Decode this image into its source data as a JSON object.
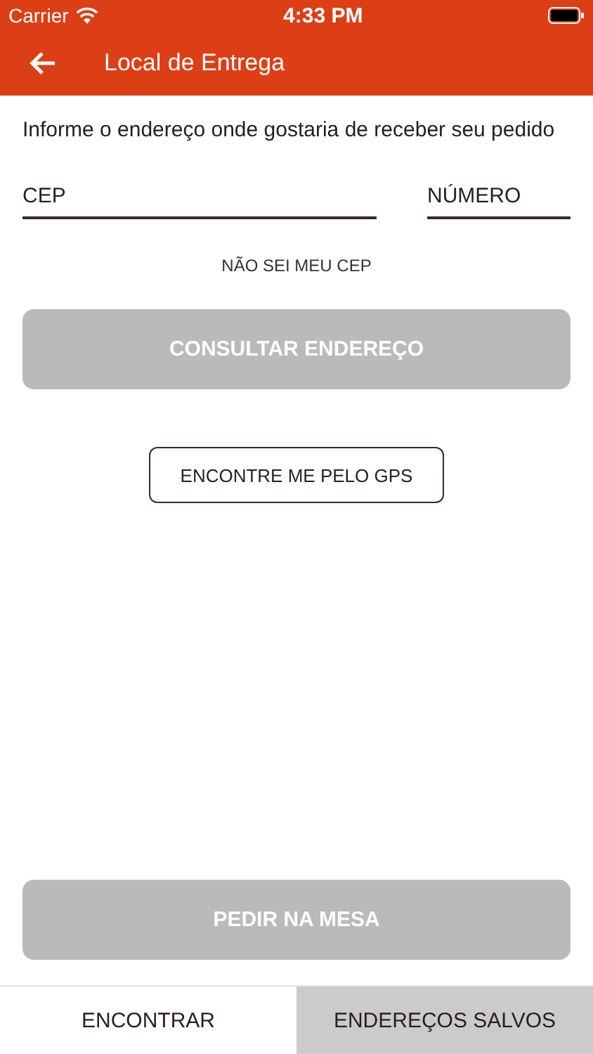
{
  "status_bar": {
    "carrier": "Carrier",
    "time": "4:33 PM"
  },
  "header": {
    "title": "Local de Entrega"
  },
  "instruction": "Informe o endereço onde gostaria de receber seu pedido",
  "fields": [
    {
      "placeholder": "CEP"
    },
    {
      "placeholder": "NÚMERO"
    }
  ],
  "unknown_cep_link": "NÃO SEI MEU CEP",
  "lookup_button": {
    "label": "CONSULTAR ENDEREÇO",
    "disabled": true
  },
  "gps_button": {
    "label": "ENCONTRE ME PELO GPS"
  },
  "table_order_button": {
    "label": "PEDIR NA MESA",
    "disabled": true
  },
  "tabs": [
    {
      "label": "ENCONTRAR",
      "selected": true
    },
    {
      "label": "ENDEREÇOS SALVOS",
      "selected": false
    }
  ]
}
